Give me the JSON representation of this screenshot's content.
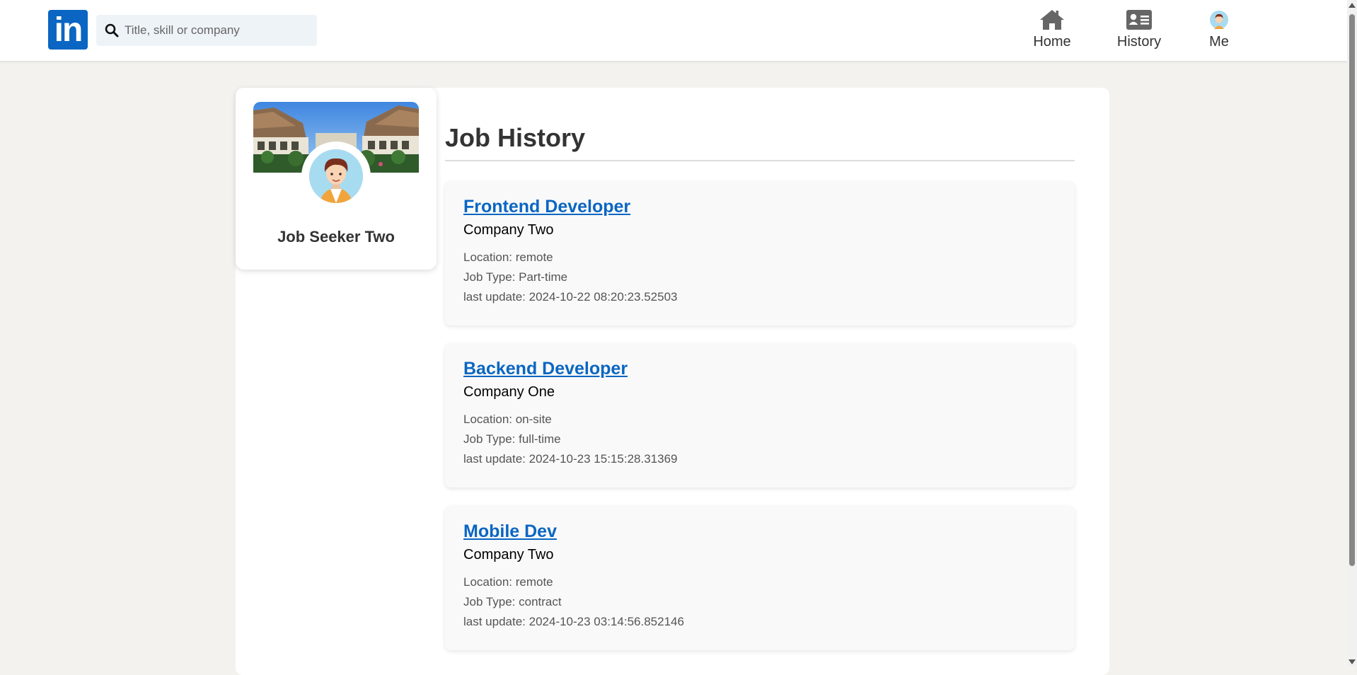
{
  "nav": {
    "logo_text": "in",
    "search_placeholder": "Title, skill or company",
    "items": [
      {
        "label": "Home",
        "icon": "home-icon"
      },
      {
        "label": "History",
        "icon": "id-card-icon"
      },
      {
        "label": "Me",
        "icon": "avatar-icon"
      }
    ]
  },
  "profile": {
    "name": "Job Seeker Two"
  },
  "page": {
    "title": "Job History"
  },
  "jobs": [
    {
      "title": "Frontend Developer",
      "company": "Company Two",
      "location": "Location: remote",
      "job_type": "Job Type: Part-time",
      "last_update": "last update: 2024-10-22 08:20:23.52503"
    },
    {
      "title": "Backend Developer",
      "company": "Company One",
      "location": "Location: on-site",
      "job_type": "Job Type: full-time",
      "last_update": "last update: 2024-10-23 15:15:28.31369"
    },
    {
      "title": "Mobile Dev",
      "company": "Company Two",
      "location": "Location: remote",
      "job_type": "Job Type: contract",
      "last_update": "last update: 2024-10-23 03:14:56.852146"
    }
  ],
  "colors": {
    "brand": "#0a66c2",
    "background": "#f3f2ef"
  }
}
